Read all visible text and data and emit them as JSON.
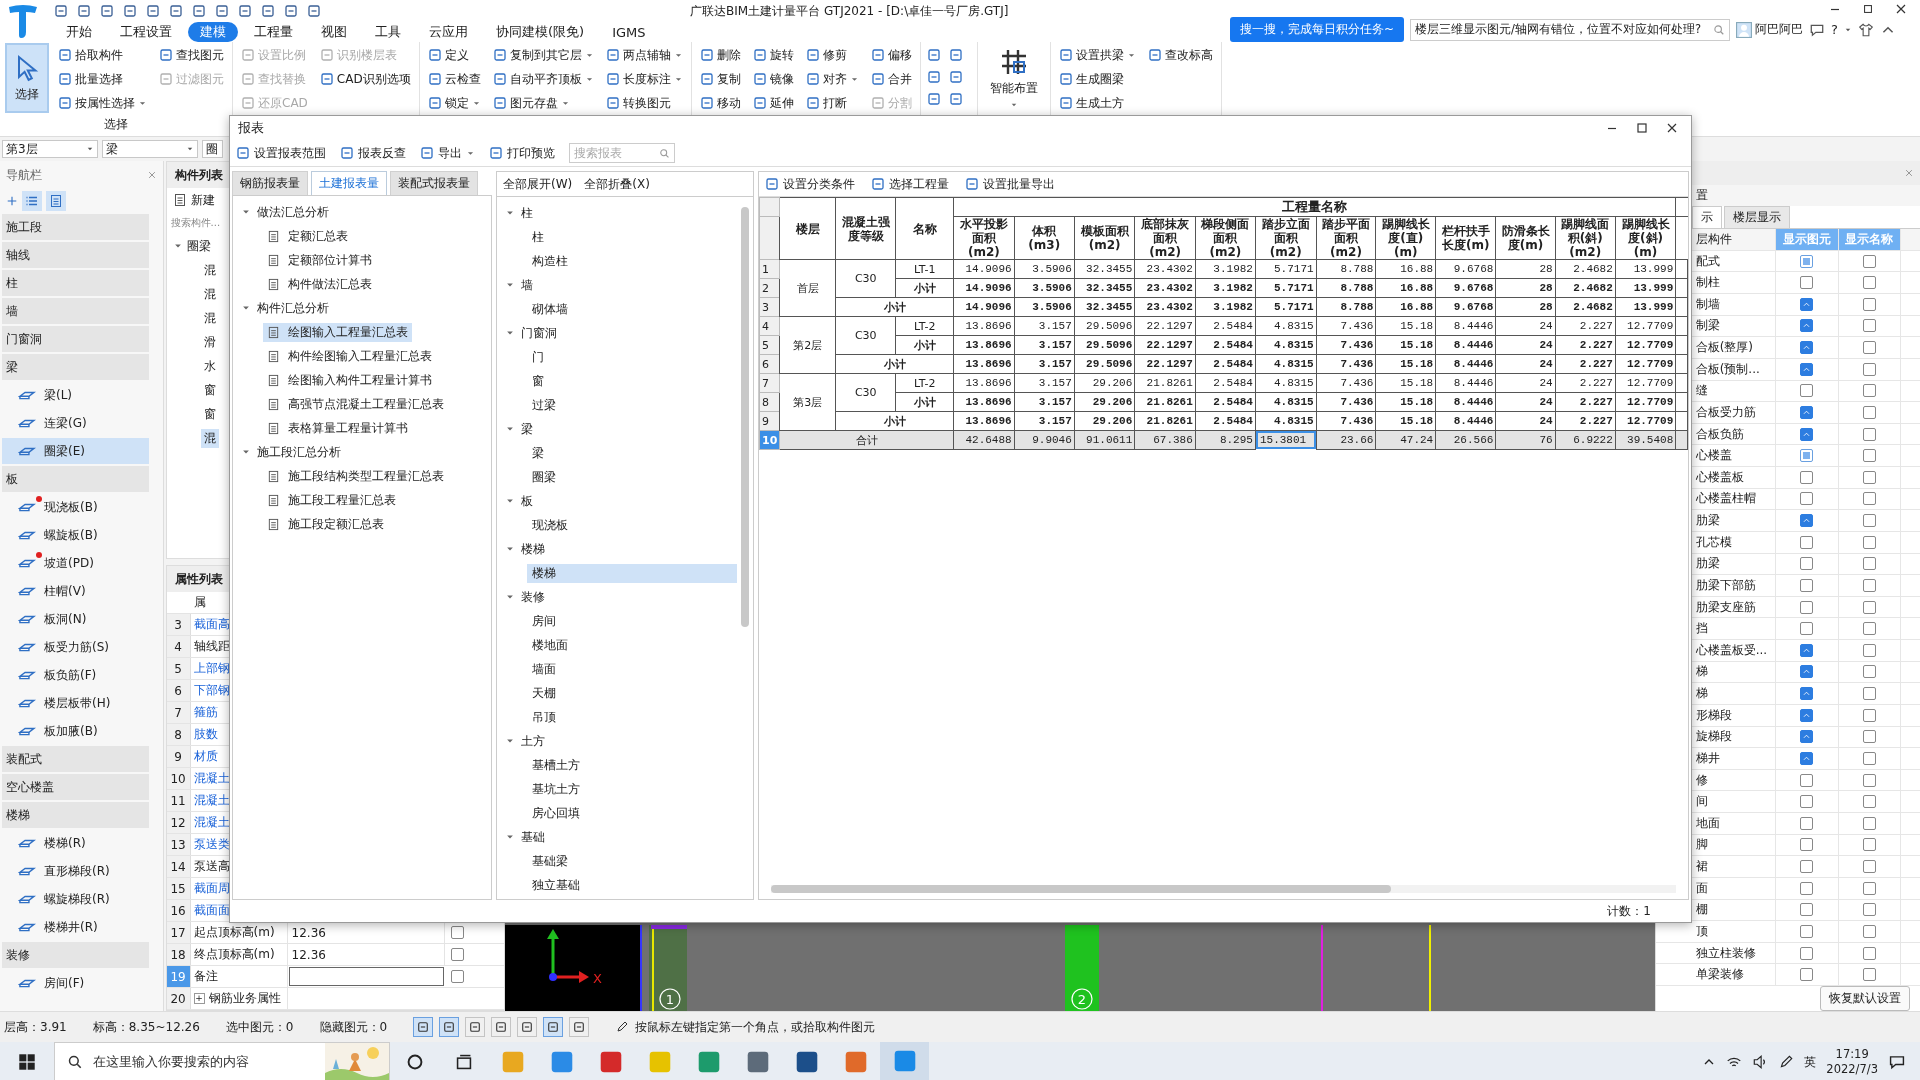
{
  "app": {
    "title": "广联达BIM土建计量平台 GTJ2021 - [D:\\卓佳一号厂房.GTJ]",
    "promo": "搜一搜，完成每日积分任务~",
    "help_search": "楼层三维显示图元/轴网有错位，位置不对应如何处理?",
    "user": "阿巴阿巴",
    "help": "?"
  },
  "ribbon": {
    "tabs": [
      {
        "label": "开始",
        "selected": false
      },
      {
        "label": "工程设置",
        "selected": false
      },
      {
        "label": "建模",
        "selected": true
      },
      {
        "label": "工程量",
        "selected": false
      },
      {
        "label": "视图",
        "selected": false
      },
      {
        "label": "工具",
        "selected": false
      },
      {
        "label": "云应用",
        "selected": false
      },
      {
        "label": "协同建模(限免)",
        "selected": false
      },
      {
        "label": "IGMS",
        "selected": false
      }
    ],
    "groups": [
      {
        "label": "选择",
        "columns": [
          [
            {
              "label": "选择",
              "kind": "large",
              "selected": true,
              "disabled": false,
              "dropdown": false
            }
          ],
          [
            {
              "label": "拾取构件",
              "kind": "small",
              "selected": false,
              "disabled": false,
              "dropdown": false
            },
            {
              "label": "批量选择",
              "kind": "small",
              "selected": false,
              "disabled": false,
              "dropdown": false
            },
            {
              "label": "按属性选择",
              "kind": "small",
              "selected": false,
              "disabled": false,
              "dropdown": true
            }
          ],
          [
            {
              "label": "查找图元",
              "kind": "small",
              "selected": false,
              "disabled": false,
              "dropdown": false
            },
            {
              "label": "过滤图元",
              "kind": "small",
              "selected": false,
              "disabled": true,
              "dropdown": false
            }
          ]
        ]
      },
      {
        "columns": [
          [
            {
              "label": "设置比例",
              "kind": "small",
              "selected": false,
              "disabled": true,
              "dropdown": false
            },
            {
              "label": "查找替换",
              "kind": "small",
              "selected": false,
              "disabled": true,
              "dropdown": false
            },
            {
              "label": "还原CAD",
              "kind": "small",
              "selected": false,
              "disabled": true,
              "dropdown": false
            }
          ],
          [
            {
              "label": "识别楼层表",
              "kind": "small",
              "selected": false,
              "disabled": true,
              "dropdown": false
            },
            {
              "label": "CAD识别选项",
              "kind": "small",
              "selected": false,
              "disabled": false,
              "dropdown": false
            }
          ]
        ]
      },
      {
        "columns": [
          [
            {
              "label": "定义",
              "kind": "small",
              "selected": false,
              "disabled": false,
              "dropdown": false
            },
            {
              "label": "云检查",
              "kind": "small",
              "selected": false,
              "disabled": false,
              "dropdown": false
            },
            {
              "label": "锁定",
              "kind": "small",
              "selected": false,
              "disabled": false,
              "dropdown": true
            }
          ],
          [
            {
              "label": "复制到其它层",
              "kind": "small",
              "selected": false,
              "disabled": false,
              "dropdown": true
            },
            {
              "label": "自动平齐顶板",
              "kind": "small",
              "selected": false,
              "disabled": false,
              "dropdown": true
            },
            {
              "label": "图元存盘",
              "kind": "small",
              "selected": false,
              "disabled": false,
              "dropdown": true
            }
          ],
          [
            {
              "label": "两点辅轴",
              "kind": "small",
              "selected": false,
              "disabled": false,
              "dropdown": true
            },
            {
              "label": "长度标注",
              "kind": "small",
              "selected": false,
              "disabled": false,
              "dropdown": true
            },
            {
              "label": "转换图元",
              "kind": "small",
              "selected": false,
              "disabled": false,
              "dropdown": false
            }
          ]
        ]
      },
      {
        "columns": [
          [
            {
              "label": "删除",
              "kind": "small",
              "selected": false,
              "disabled": false,
              "dropdown": false
            },
            {
              "label": "复制",
              "kind": "small",
              "selected": false,
              "disabled": false,
              "dropdown": false
            },
            {
              "label": "移动",
              "kind": "small",
              "selected": false,
              "disabled": false,
              "dropdown": false
            }
          ],
          [
            {
              "label": "旋转",
              "kind": "small",
              "selected": false,
              "disabled": false,
              "dropdown": false
            },
            {
              "label": "镜像",
              "kind": "small",
              "selected": false,
              "disabled": false,
              "dropdown": false
            },
            {
              "label": "延伸",
              "kind": "small",
              "selected": false,
              "disabled": false,
              "dropdown": false
            }
          ],
          [
            {
              "label": "修剪",
              "kind": "small",
              "selected": false,
              "disabled": false,
              "dropdown": false
            },
            {
              "label": "对齐",
              "kind": "small",
              "selected": false,
              "disabled": false,
              "dropdown": true
            },
            {
              "label": "打断",
              "kind": "small",
              "selected": false,
              "disabled": false,
              "dropdown": false
            }
          ],
          [
            {
              "label": "偏移",
              "kind": "small",
              "selected": false,
              "disabled": false,
              "dropdown": false
            },
            {
              "label": "合并",
              "kind": "small",
              "selected": false,
              "disabled": false,
              "dropdown": false
            },
            {
              "label": "分割",
              "kind": "small",
              "selected": false,
              "disabled": true,
              "dropdown": false
            }
          ]
        ]
      },
      {
        "kind": "icons"
      },
      {
        "columns": [
          [
            {
              "label": "智能布置",
              "kind": "large",
              "selected": false,
              "disabled": false,
              "dropdown": true
            }
          ]
        ]
      },
      {
        "columns": [
          [
            {
              "label": "设置拱梁",
              "kind": "small",
              "selected": false,
              "disabled": false,
              "dropdown": true
            },
            {
              "label": "生成圈梁",
              "kind": "small",
              "selected": false,
              "disabled": false,
              "dropdown": false
            },
            {
              "label": "生成土方",
              "kind": "small",
              "selected": false,
              "disabled": false,
              "dropdown": false
            }
          ],
          [
            {
              "label": "查改标高",
              "kind": "small",
              "selected": false,
              "disabled": false,
              "dropdown": false
            }
          ]
        ]
      }
    ]
  },
  "selectors": [
    "第3层",
    "梁",
    "圈"
  ],
  "navigator": {
    "title": "导航栏",
    "items": [
      {
        "kind": "category",
        "label": "施工段",
        "selected": false
      },
      {
        "kind": "category",
        "label": "轴线",
        "selected": false
      },
      {
        "kind": "category",
        "label": "柱",
        "selected": false
      },
      {
        "kind": "category",
        "label": "墙",
        "selected": false
      },
      {
        "kind": "category",
        "label": "门窗洞",
        "selected": false
      },
      {
        "kind": "category",
        "label": "梁",
        "selected": false
      },
      {
        "kind": "item",
        "label": "梁(L)",
        "selected": false,
        "marked": false
      },
      {
        "kind": "item",
        "label": "连梁(G)",
        "selected": false,
        "marked": false
      },
      {
        "kind": "item",
        "label": "圈梁(E)",
        "selected": true,
        "marked": false
      },
      {
        "kind": "category",
        "label": "板",
        "selected": false
      },
      {
        "kind": "item",
        "label": "现浇板(B)",
        "selected": false,
        "marked": true
      },
      {
        "kind": "item",
        "label": "螺旋板(B)",
        "selected": false,
        "marked": false
      },
      {
        "kind": "item",
        "label": "坡道(PD)",
        "selected": false,
        "marked": true
      },
      {
        "kind": "item",
        "label": "柱帽(V)",
        "selected": false,
        "marked": false
      },
      {
        "kind": "item",
        "label": "板洞(N)",
        "selected": false,
        "marked": false
      },
      {
        "kind": "item",
        "label": "板受力筋(S)",
        "selected": false,
        "marked": false
      },
      {
        "kind": "item",
        "label": "板负筋(F)",
        "selected": false,
        "marked": false
      },
      {
        "kind": "item",
        "label": "楼层板带(H)",
        "selected": false,
        "marked": false
      },
      {
        "kind": "item",
        "label": "板加腋(B)",
        "selected": false,
        "marked": false
      },
      {
        "kind": "category",
        "label": "装配式",
        "selected": false
      },
      {
        "kind": "category",
        "label": "空心楼盖",
        "selected": false
      },
      {
        "kind": "category",
        "label": "楼梯",
        "selected": false
      },
      {
        "kind": "item",
        "label": "楼梯(R)",
        "selected": false,
        "marked": false
      },
      {
        "kind": "item",
        "label": "直形梯段(R)",
        "selected": false,
        "marked": false
      },
      {
        "kind": "item",
        "label": "螺旋梯段(R)",
        "selected": false,
        "marked": false
      },
      {
        "kind": "item",
        "label": "楼梯井(R)",
        "selected": false,
        "marked": false
      },
      {
        "kind": "category",
        "label": "装修",
        "selected": false
      },
      {
        "kind": "item",
        "label": "房间(F)",
        "selected": false,
        "marked": false
      }
    ]
  },
  "component_list": {
    "title": "构件列表",
    "new_button": "新建",
    "search_placeholder": "搜索构件...",
    "group": "圈梁",
    "items": [
      {
        "label": "混",
        "selected": false
      },
      {
        "label": "混",
        "selected": false
      },
      {
        "label": "混",
        "selected": false
      },
      {
        "label": "滑",
        "selected": false
      },
      {
        "label": "水",
        "selected": false
      },
      {
        "label": "窗",
        "selected": false
      },
      {
        "label": "窗",
        "selected": false
      },
      {
        "label": "混",
        "selected": true
      }
    ]
  },
  "property_list": {
    "title": "属性列表",
    "header": "属",
    "rows": [
      {
        "num": "3",
        "name": "截面高",
        "public": true,
        "selected": false
      },
      {
        "num": "4",
        "name": "轴线距",
        "public": false,
        "selected": false
      },
      {
        "num": "5",
        "name": "上部钢",
        "public": true,
        "selected": false
      },
      {
        "num": "6",
        "name": "下部钢",
        "public": true,
        "selected": false
      },
      {
        "num": "7",
        "name": "箍筋",
        "public": true,
        "selected": false
      },
      {
        "num": "8",
        "name": "肢数",
        "public": true,
        "selected": false
      },
      {
        "num": "9",
        "name": "材质",
        "public": true,
        "selected": false
      },
      {
        "num": "10",
        "name": "混凝土",
        "public": true,
        "selected": false
      },
      {
        "num": "11",
        "name": "混凝土",
        "public": true,
        "selected": false
      },
      {
        "num": "12",
        "name": "混凝土",
        "public": true,
        "selected": false
      },
      {
        "num": "13",
        "name": "泵送类",
        "public": true,
        "selected": false
      },
      {
        "num": "14",
        "name": "泵送高",
        "public": false,
        "selected": false
      },
      {
        "num": "15",
        "name": "截面周",
        "public": true,
        "selected": false
      },
      {
        "num": "16",
        "name": "截面面",
        "public": true,
        "selected": false
      },
      {
        "num": "17",
        "name": "起点顶标高(m)",
        "value": "12.36",
        "public": false,
        "selected": false,
        "attached": false
      },
      {
        "num": "18",
        "name": "终点顶标高(m)",
        "value": "12.36",
        "public": false,
        "selected": false,
        "attached": false
      },
      {
        "num": "19",
        "name": "备注",
        "public": false,
        "selected": true,
        "attached": false,
        "editing": true
      },
      {
        "num": "20",
        "name": "钢筋业务属性",
        "expander": "+",
        "public": false,
        "selected": false
      }
    ]
  },
  "canvas": {
    "axis_x": "X",
    "axis_labels": [
      "1",
      "2"
    ]
  },
  "display_panel": {
    "title": "置",
    "tabs": [
      {
        "label": "示",
        "selected": true
      },
      {
        "label": "楼层显示",
        "selected": false
      }
    ],
    "columns": [
      "层构件",
      "显示图元",
      "显示名称"
    ],
    "rows": [
      {
        "name": "配式",
        "checked": false,
        "mixed": true,
        "name_checked": false
      },
      {
        "name": "制柱",
        "checked": false,
        "mixed": false,
        "name_checked": false
      },
      {
        "name": "制墙",
        "checked": true,
        "mixed": false,
        "name_checked": false
      },
      {
        "name": "制梁",
        "checked": true,
        "mixed": false,
        "name_checked": false
      },
      {
        "name": "合板(整厚)",
        "checked": true,
        "mixed": false,
        "name_checked": false
      },
      {
        "name": "合板(预制...",
        "checked": true,
        "mixed": false,
        "name_checked": false
      },
      {
        "name": "缝",
        "checked": false,
        "mixed": false,
        "name_checked": false
      },
      {
        "name": "合板受力筋",
        "checked": true,
        "mixed": false,
        "name_checked": false
      },
      {
        "name": "合板负筋",
        "checked": true,
        "mixed": false,
        "name_checked": false
      },
      {
        "name": "心楼盖",
        "checked": false,
        "mixed": true,
        "name_checked": false
      },
      {
        "name": "心楼盖板",
        "checked": false,
        "mixed": false,
        "name_checked": false
      },
      {
        "name": "心楼盖柱帽",
        "checked": false,
        "mixed": false,
        "name_checked": false
      },
      {
        "name": "肋梁",
        "checked": true,
        "mixed": false,
        "name_checked": false
      },
      {
        "name": "孔芯模",
        "checked": false,
        "mixed": false,
        "name_checked": false
      },
      {
        "name": "肋梁",
        "checked": false,
        "mixed": false,
        "name_checked": false
      },
      {
        "name": "肋梁下部筋",
        "checked": false,
        "mixed": false,
        "name_checked": false
      },
      {
        "name": "肋梁支座筋",
        "checked": false,
        "mixed": false,
        "name_checked": false
      },
      {
        "name": "挡",
        "checked": false,
        "mixed": false,
        "name_checked": false
      },
      {
        "name": "心楼盖板受...",
        "checked": true,
        "mixed": false,
        "name_checked": false
      },
      {
        "name": "梯",
        "checked": true,
        "mixed": false,
        "name_checked": false
      },
      {
        "name": "梯",
        "checked": true,
        "mixed": false,
        "name_checked": false
      },
      {
        "name": "形梯段",
        "checked": true,
        "mixed": false,
        "name_checked": false
      },
      {
        "name": "旋梯段",
        "checked": true,
        "mixed": false,
        "name_checked": false
      },
      {
        "name": "梯井",
        "checked": true,
        "mixed": false,
        "name_checked": false
      },
      {
        "name": "修",
        "checked": false,
        "mixed": false,
        "name_checked": false
      },
      {
        "name": "间",
        "checked": false,
        "mixed": false,
        "name_checked": false
      },
      {
        "name": "地面",
        "checked": false,
        "mixed": false,
        "name_checked": false
      },
      {
        "name": "脚",
        "checked": false,
        "mixed": false,
        "name_checked": false
      },
      {
        "name": "裙",
        "checked": false,
        "mixed": false,
        "name_checked": false
      },
      {
        "name": "面",
        "checked": false,
        "mixed": false,
        "name_checked": false
      },
      {
        "name": "棚",
        "checked": false,
        "mixed": false,
        "name_checked": false
      },
      {
        "name": "顶",
        "checked": false,
        "mixed": false,
        "name_checked": false
      },
      {
        "name": "独立柱装修",
        "checked": false,
        "mixed": false,
        "name_checked": false
      },
      {
        "name": "单梁装修",
        "checked": false,
        "mixed": false,
        "name_checked": false
      }
    ],
    "reset_button": "恢复默认设置"
  },
  "report_dialog": {
    "title": "报表",
    "toolbar": [
      {
        "label": "设置报表范围",
        "dropdown": false
      },
      {
        "label": "报表反查",
        "dropdown": false
      },
      {
        "label": "导出",
        "dropdown": true
      },
      {
        "label": "打印预览",
        "dropdown": false
      }
    ],
    "search_placeholder": "搜索报表",
    "tabs": [
      {
        "label": "钢筋报表量",
        "selected": false
      },
      {
        "label": "土建报表量",
        "selected": true
      },
      {
        "label": "装配式报表量",
        "selected": false
      }
    ],
    "report_tree": [
      {
        "label": "做法汇总分析",
        "expanded": true,
        "children": [
          {
            "label": "定额汇总表",
            "selected": false
          },
          {
            "label": "定额部位计算书",
            "selected": false
          },
          {
            "label": "构件做法汇总表",
            "selected": false
          }
        ]
      },
      {
        "label": "构件汇总分析",
        "expanded": true,
        "children": [
          {
            "label": "绘图输入工程量汇总表",
            "selected": true
          },
          {
            "label": "构件绘图输入工程量汇总表",
            "selected": false
          },
          {
            "label": "绘图输入构件工程量计算书",
            "selected": false
          },
          {
            "label": "高强节点混凝土工程量汇总表",
            "selected": false
          },
          {
            "label": "表格算量工程量计算书",
            "selected": false
          }
        ]
      },
      {
        "label": "施工段汇总分析",
        "expanded": true,
        "children": [
          {
            "label": "施工段结构类型工程量汇总表",
            "selected": false
          },
          {
            "label": "施工段工程量汇总表",
            "selected": false
          },
          {
            "label": "施工段定额汇总表",
            "selected": false
          }
        ]
      }
    ],
    "expand_all": "全部展开(W)",
    "collapse_all": "全部折叠(X)",
    "component_tree": [
      {
        "label": "柱",
        "expanded": true,
        "children": [
          {
            "label": "柱",
            "selected": false
          },
          {
            "label": "构造柱",
            "selected": false
          }
        ]
      },
      {
        "label": "墙",
        "expanded": true,
        "children": [
          {
            "label": "砌体墙",
            "selected": false
          }
        ]
      },
      {
        "label": "门窗洞",
        "expanded": true,
        "children": [
          {
            "label": "门",
            "selected": false
          },
          {
            "label": "窗",
            "selected": false
          },
          {
            "label": "过梁",
            "selected": false
          }
        ]
      },
      {
        "label": "梁",
        "expanded": true,
        "children": [
          {
            "label": "梁",
            "selected": false
          },
          {
            "label": "圈梁",
            "selected": false
          }
        ]
      },
      {
        "label": "板",
        "expanded": true,
        "children": [
          {
            "label": "现浇板",
            "selected": false
          }
        ]
      },
      {
        "label": "楼梯",
        "expanded": true,
        "children": [
          {
            "label": "楼梯",
            "selected": true
          }
        ]
      },
      {
        "label": "装修",
        "expanded": true,
        "children": [
          {
            "label": "房间",
            "selected": false
          },
          {
            "label": "楼地面",
            "selected": false
          },
          {
            "label": "墙面",
            "selected": false
          },
          {
            "label": "天棚",
            "selected": false
          },
          {
            "label": "吊顶",
            "selected": false
          }
        ]
      },
      {
        "label": "土方",
        "expanded": true,
        "children": [
          {
            "label": "基槽土方",
            "selected": false
          },
          {
            "label": "基坑土方",
            "selected": false
          },
          {
            "label": "房心回填",
            "selected": false
          }
        ]
      },
      {
        "label": "基础",
        "expanded": true,
        "children": [
          {
            "label": "基础梁",
            "selected": false
          },
          {
            "label": "独立基础",
            "selected": false
          }
        ]
      }
    ],
    "table_toolbar": [
      "设置分类条件",
      "选择工程量",
      "设置批量导出"
    ],
    "table": {
      "left_headers": [
        "楼层",
        "混凝土强度等级",
        "名称"
      ],
      "group_header": "工程量名称",
      "columns": [
        "水平投影面积(m2)",
        "体积(m3)",
        "模板面积(m2)",
        "底部抹灰面积(m2)",
        "梯段侧面面积(m2)",
        "踏步立面面积(m2)",
        "踏步平面面积(m2)",
        "踢脚线长度(直)(m)",
        "栏杆扶手长度(m)",
        "防滑条长度(m)",
        "踢脚线面积(斜)(m2)",
        "踢脚线长度(斜)(m)"
      ],
      "floors": [
        {
          "floor": "首层",
          "grade": "C30",
          "item": {
            "row_number": "1",
            "name": "LT-1",
            "selected": false,
            "values": [
              "14.9096",
              "3.5906",
              "32.3455",
              "23.4302",
              "3.1982",
              "5.7171",
              "8.788",
              "16.88",
              "9.6768",
              "28",
              "2.4682",
              "13.999"
            ]
          },
          "subtotal": {
            "row_number": "2",
            "label": "小计",
            "selected": false,
            "values": [
              "14.9096",
              "3.5906",
              "32.3455",
              "23.4302",
              "3.1982",
              "5.7171",
              "8.788",
              "16.88",
              "9.6768",
              "28",
              "2.4682",
              "13.999"
            ]
          },
          "total": {
            "row_number": "3",
            "label": "小计",
            "selected": false,
            "values": [
              "14.9096",
              "3.5906",
              "32.3455",
              "23.4302",
              "3.1982",
              "5.7171",
              "8.788",
              "16.88",
              "9.6768",
              "28",
              "2.4682",
              "13.999"
            ]
          }
        },
        {
          "floor": "第2层",
          "grade": "C30",
          "item": {
            "row_number": "4",
            "name": "LT-2",
            "selected": false,
            "values": [
              "13.8696",
              "3.157",
              "29.5096",
              "22.1297",
              "2.5484",
              "4.8315",
              "7.436",
              "15.18",
              "8.4446",
              "24",
              "2.227",
              "12.7709"
            ]
          },
          "subtotal": {
            "row_number": "5",
            "label": "小计",
            "selected": false,
            "values": [
              "13.8696",
              "3.157",
              "29.5096",
              "22.1297",
              "2.5484",
              "4.8315",
              "7.436",
              "15.18",
              "8.4446",
              "24",
              "2.227",
              "12.7709"
            ]
          },
          "total": {
            "row_number": "6",
            "label": "小计",
            "selected": false,
            "values": [
              "13.8696",
              "3.157",
              "29.5096",
              "22.1297",
              "2.5484",
              "4.8315",
              "7.436",
              "15.18",
              "8.4446",
              "24",
              "2.227",
              "12.7709"
            ]
          }
        },
        {
          "floor": "第3层",
          "grade": "C30",
          "item": {
            "row_number": "7",
            "name": "LT-2",
            "selected": false,
            "values": [
              "13.8696",
              "3.157",
              "29.206",
              "21.8261",
              "2.5484",
              "4.8315",
              "7.436",
              "15.18",
              "8.4446",
              "24",
              "2.227",
              "12.7709"
            ]
          },
          "subtotal": {
            "row_number": "8",
            "label": "小计",
            "selected": false,
            "values": [
              "13.8696",
              "3.157",
              "29.206",
              "21.8261",
              "2.5484",
              "4.8315",
              "7.436",
              "15.18",
              "8.4446",
              "24",
              "2.227",
              "12.7709"
            ]
          },
          "total": {
            "row_number": "9",
            "label": "小计",
            "selected": false,
            "values": [
              "13.8696",
              "3.157",
              "29.206",
              "21.8261",
              "2.5484",
              "4.8315",
              "7.436",
              "15.18",
              "8.4446",
              "24",
              "2.227",
              "12.7709"
            ]
          }
        }
      ],
      "grand_total": {
        "row_number": "10",
        "label": "合计",
        "selected": true,
        "values": [
          {
            "text": "42.6488",
            "selected": false
          },
          {
            "text": "9.9046",
            "selected": false
          },
          {
            "text": "91.0611",
            "selected": false
          },
          {
            "text": "67.386",
            "selected": false
          },
          {
            "text": "8.295",
            "selected": false
          },
          {
            "text": "15.3801",
            "selected": true
          },
          {
            "text": "23.66",
            "selected": false
          },
          {
            "text": "47.24",
            "selected": false
          },
          {
            "text": "26.566",
            "selected": false
          },
          {
            "text": "76",
            "selected": false
          },
          {
            "text": "6.9222",
            "selected": false
          },
          {
            "text": "39.5408",
            "selected": false
          }
        ]
      }
    },
    "count": "计数：1"
  },
  "status_bar": {
    "floor_height": "层高：3.91",
    "elevation": "标高：8.35~12.26",
    "selected": "选中图元：0",
    "hidden": "隐藏图元：0",
    "hint": "按鼠标左键指定第一个角点，或拾取构件图元"
  },
  "taskbar": {
    "search_placeholder": "在这里输入你要搜索的内容",
    "ime": "英",
    "time": "17:19",
    "date": "2022/7/3"
  }
}
